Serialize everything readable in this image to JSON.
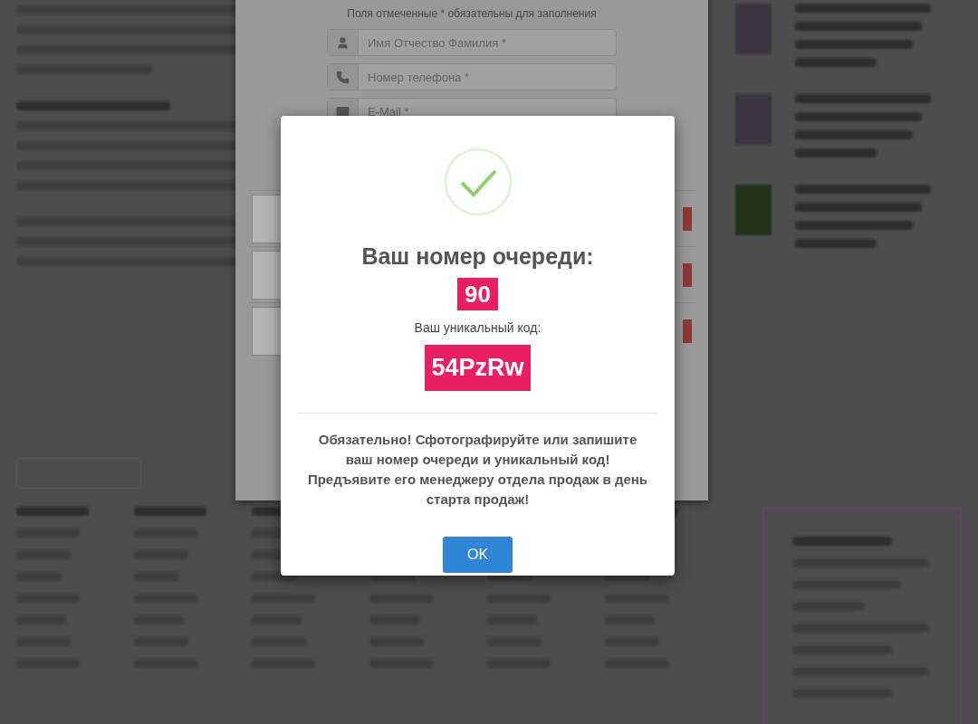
{
  "background_form": {
    "caption": "Поля отмеченные * обязательны для заполнения",
    "fields": [
      {
        "kind": "name",
        "placeholder": "Имя Отчество Фамилия *"
      },
      {
        "kind": "phone",
        "placeholder": "Номер телефона *"
      },
      {
        "kind": "email",
        "placeholder": "E-Mail *"
      }
    ]
  },
  "modal": {
    "title": "Ваш номер очереди:",
    "queue_number": "90",
    "code_label": "Ваш уникальный код:",
    "code": "54PzRw",
    "notice": "Обязательно! Сфотографируйте или запишите ваш номер очереди и уникальный код! Предъявите его менеджеру отдела продаж в день старта продаж!",
    "button": "OK"
  }
}
